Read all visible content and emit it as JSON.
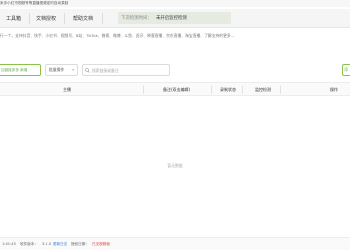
{
  "window": {
    "title": "米手小红书视频号等直播视频定时自动录制"
  },
  "toolbar": {
    "tabs": [
      {
        "label": "工具箱"
      },
      {
        "label": "文档授权"
      },
      {
        "label": "帮助文档"
      }
    ],
    "monitor_label": "下次检测时间：",
    "monitor_value": "未开启监控检测"
  },
  "description": "行一个，支持抖音、快手、小红书、视频号、B站、TikTok、微视、微博、斗鱼、虎牙、映客直播、京东直播、淘宝直播、了解支持的更多...",
  "actions": {
    "add_label": "加链接多多 新增",
    "batch_label": "批量操作",
    "search_placeholder": "搜索链接或备注",
    "right_label": "添"
  },
  "table": {
    "columns": [
      "主播",
      "备注(双击编辑)",
      "录制状态",
      "监控检测",
      "操作"
    ]
  },
  "empty_text": "暂无数据",
  "status": {
    "time": "1:41:45",
    "version_label": "软件版本：",
    "version": "3.1.0",
    "update_label": "更新日志",
    "expiry": "授权日期：",
    "warning": "已无视频帧"
  },
  "colors": {
    "accent_green": "#6aa84f",
    "link_blue": "#3c78d8",
    "warning_red": "#e53935"
  }
}
